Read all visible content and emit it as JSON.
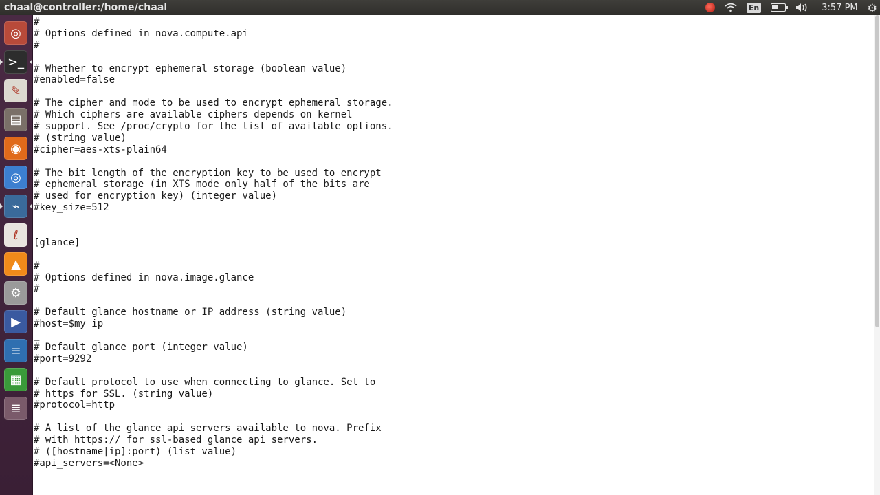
{
  "topbar": {
    "title": "chaal@controller:/home/chaal",
    "keyboard_layout": "En",
    "clock": "3:57 PM"
  },
  "launcher": {
    "items": [
      {
        "name": "dash-home",
        "icon": "ubuntu-logo-icon",
        "color": "#b84a3a",
        "glyph": "◎"
      },
      {
        "name": "terminal",
        "icon": "terminal-icon",
        "color": "#2d2d2d",
        "glyph": ">_",
        "running": true
      },
      {
        "name": "text-editor",
        "icon": "text-editor-icon",
        "color": "#dcd9d0",
        "glyph": "✎"
      },
      {
        "name": "file-manager",
        "icon": "files-icon",
        "color": "#7a7068",
        "glyph": "▤"
      },
      {
        "name": "firefox",
        "icon": "firefox-icon",
        "color": "#e06a1a",
        "glyph": "◉"
      },
      {
        "name": "chromium",
        "icon": "chromium-icon",
        "color": "#3c7fd0",
        "glyph": "◎"
      },
      {
        "name": "system-monitor",
        "icon": "system-monitor-icon",
        "color": "#3a6a9a",
        "glyph": "⌁",
        "running": true
      },
      {
        "name": "pdf-viewer",
        "icon": "document-viewer-icon",
        "color": "#e8e4df",
        "glyph": "ℓ"
      },
      {
        "name": "vlc",
        "icon": "vlc-icon",
        "color": "#f08a1a",
        "glyph": "▲"
      },
      {
        "name": "screenshot",
        "icon": "screenshot-icon",
        "color": "#9a9a9a",
        "glyph": "⚙"
      },
      {
        "name": "media-player",
        "icon": "media-player-icon",
        "color": "#3a5aa0",
        "glyph": "▶"
      },
      {
        "name": "writer",
        "icon": "libreoffice-writer-icon",
        "color": "#2f6fb0",
        "glyph": "≡"
      },
      {
        "name": "calc",
        "icon": "libreoffice-calc-icon",
        "color": "#3a9a3a",
        "glyph": "▦"
      },
      {
        "name": "stacked-apps",
        "icon": "more-apps-icon",
        "color": "#7a5a6a",
        "glyph": "≣"
      }
    ]
  },
  "terminal": {
    "lines": [
      "#",
      "# Options defined in nova.compute.api",
      "#",
      "",
      "# Whether to encrypt ephemeral storage (boolean value)",
      "#enabled=false",
      "",
      "# The cipher and mode to be used to encrypt ephemeral storage.",
      "# Which ciphers are available ciphers depends on kernel",
      "# support. See /proc/crypto for the list of available options.",
      "# (string value)",
      "#cipher=aes-xts-plain64",
      "",
      "# The bit length of the encryption key to be used to encrypt",
      "# ephemeral storage (in XTS mode only half of the bits are",
      "# used for encryption key) (integer value)",
      "#key_size=512",
      "",
      "",
      "[glance]",
      "",
      "#",
      "# Options defined in nova.image.glance",
      "#",
      "",
      "# Default glance hostname or IP address (string value)",
      "#host=$my_ip",
      "_",
      "# Default glance port (integer value)",
      "#port=9292",
      "",
      "# Default protocol to use when connecting to glance. Set to",
      "# https for SSL. (string value)",
      "#protocol=http",
      "",
      "# A list of the glance api servers available to nova. Prefix",
      "# with https:// for ssl-based glance api servers.",
      "# ([hostname|ip]:port) (list value)",
      "#api_servers=<None>"
    ]
  },
  "scrollbar": {
    "position_fraction": 0.0,
    "visible_fraction": 0.65
  }
}
